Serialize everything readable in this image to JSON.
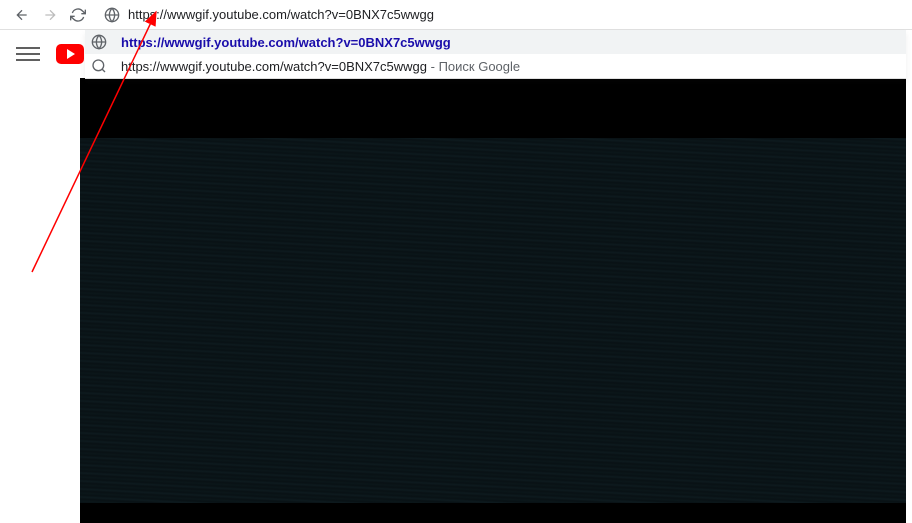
{
  "browser": {
    "url": "https://wwwgif.youtube.com/watch?v=0BNX7c5wwgg",
    "suggestions": [
      {
        "type": "url",
        "text": "https://wwwgif.youtube.com/watch?v=0BNX7c5wwgg",
        "highlighted": true
      },
      {
        "type": "search",
        "text": "https://wwwgif.youtube.com/watch?v=0BNX7c5wwgg",
        "suffix": " - Поиск Google",
        "highlighted": false
      }
    ]
  }
}
